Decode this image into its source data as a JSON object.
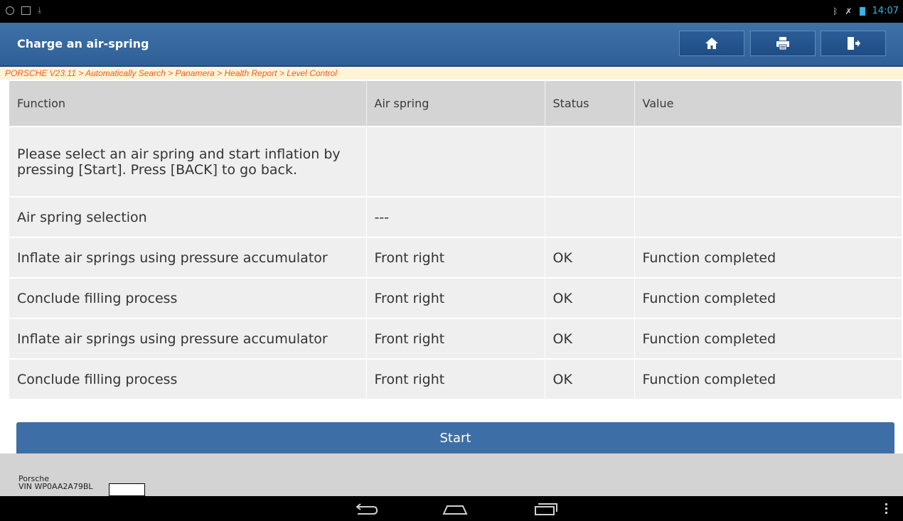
{
  "statusbar": {
    "time": "14:07"
  },
  "window": {
    "title": "Charge an air-spring"
  },
  "toolbar": {
    "home_icon": "home-icon",
    "print_icon": "print-icon",
    "exit_icon": "exit-icon"
  },
  "breadcrumb": "PORSCHE V23.11 > Automatically Search > Panamera > Health Report > Level Control",
  "table": {
    "headers": [
      "Function",
      "Air spring",
      "Status",
      "Value"
    ],
    "rows": [
      [
        "Please select an air spring and start inflation by pressing [Start]. Press [BACK] to go back.",
        "",
        "",
        ""
      ],
      [
        "Air spring selection",
        "---",
        "",
        ""
      ],
      [
        "Inflate air springs using pressure accumulator",
        "Front right",
        "OK",
        "Function completed"
      ],
      [
        "Conclude filling process",
        "Front right",
        "OK",
        "Function completed"
      ],
      [
        "Inflate air springs using pressure accumulator",
        "Front right",
        "OK",
        "Function completed"
      ],
      [
        "Conclude filling process",
        "Front right",
        "OK",
        "Function completed"
      ]
    ]
  },
  "start_button": "Start",
  "footer": {
    "brand": "Porsche",
    "vin": "VIN WP0AA2A79BL"
  }
}
